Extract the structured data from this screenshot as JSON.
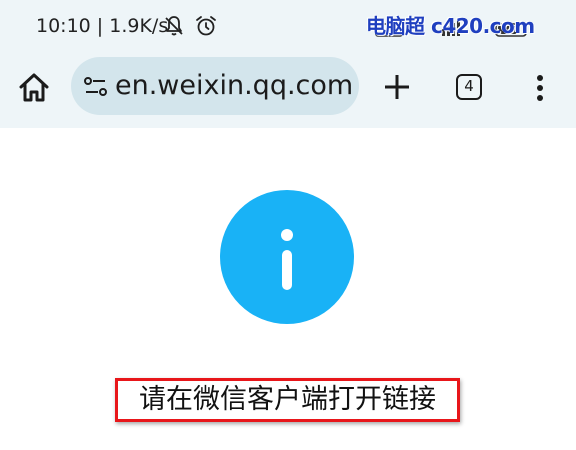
{
  "status_bar": {
    "time_speed": "10:10 | 1.9K/s",
    "watermark": "电脑超 c420.com",
    "icons": [
      "muted-bell-icon",
      "alarm-icon",
      "signal-icon",
      "battery-icon"
    ]
  },
  "toolbar": {
    "home_icon": "home-icon",
    "site_info_icon": "site-settings-icon",
    "url": "en.weixin.qq.com",
    "new_tab_icon": "plus-icon",
    "tab_count": "4",
    "menu_icon": "more-vert-icon"
  },
  "content": {
    "info_icon": "info-icon",
    "info_color": "#19b2f6",
    "message": "请在微信客户端打开链接",
    "highlight_color": "#e8161a"
  }
}
